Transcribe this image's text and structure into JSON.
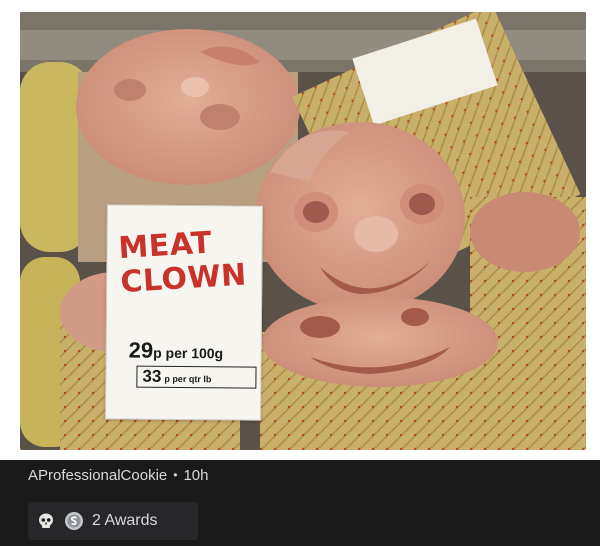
{
  "sign": {
    "title": "MEAT\nCLOWN",
    "price_main": "29",
    "price_main_unit": "p per 100g",
    "price_alt": "33",
    "price_alt_unit": "p per qtr lb"
  },
  "post": {
    "username": "AProfessionalCookie",
    "separator": "•",
    "age": "10h",
    "awards_label": "2 Awards"
  },
  "colors": {
    "bar_bg": "#1a1a1b",
    "awards_bg": "#272729",
    "sign_red": "#c8322a",
    "meat_pink": "#d69a86",
    "casing_gold": "#c9b06a"
  },
  "icons": [
    "skull-award-icon",
    "silver-award-icon"
  ]
}
